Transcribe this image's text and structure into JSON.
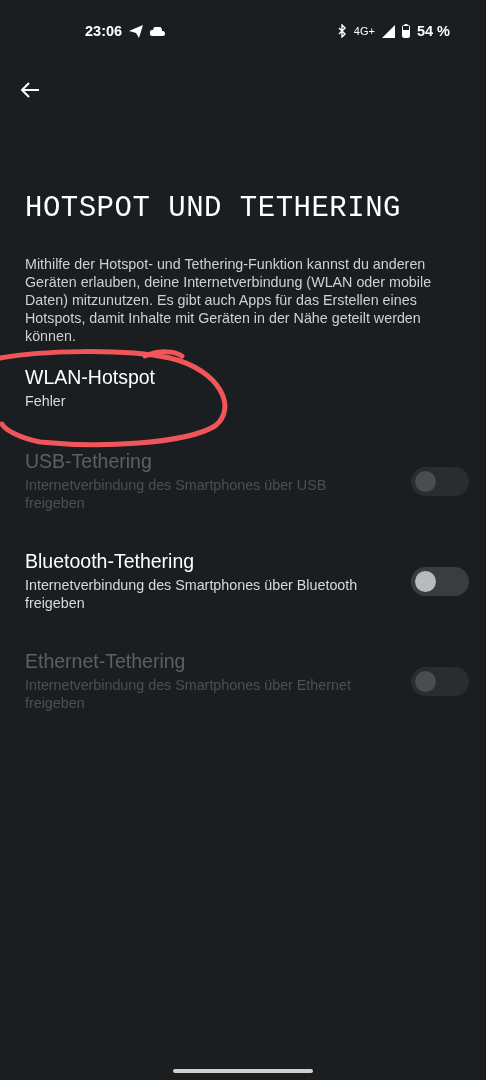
{
  "status_bar": {
    "time": "23:06",
    "network": "4G+",
    "battery": "54 %"
  },
  "title": "HOTSPOT UND TETHERING",
  "description": "Mithilfe der Hotspot- und Tethering-Funktion kannst du anderen Geräten erlauben, deine Internetverbindung (WLAN oder mobile Daten) mitzunutzen. Es gibt auch Apps für das Erstellen eines Hotspots, damit Inhalte mit Geräten in der Nähe geteilt werden können.",
  "items": [
    {
      "kind": "plain",
      "title": "WLAN-Hotspot",
      "summary": "Fehler",
      "disabled": false
    },
    {
      "kind": "toggle",
      "title": "USB-Tethering",
      "summary": "Internetverbindung des Smartphones über USB freigeben",
      "disabled": true,
      "on": false
    },
    {
      "kind": "toggle",
      "title": "Bluetooth-Tethering",
      "summary": "Internetverbindung des Smartphones über Bluetooth freigeben",
      "disabled": false,
      "on": false
    },
    {
      "kind": "toggle",
      "title": "Ethernet-Tethering",
      "summary": "Internetverbindung des Smartphones über Ethernet freigeben",
      "disabled": true,
      "on": false
    }
  ]
}
